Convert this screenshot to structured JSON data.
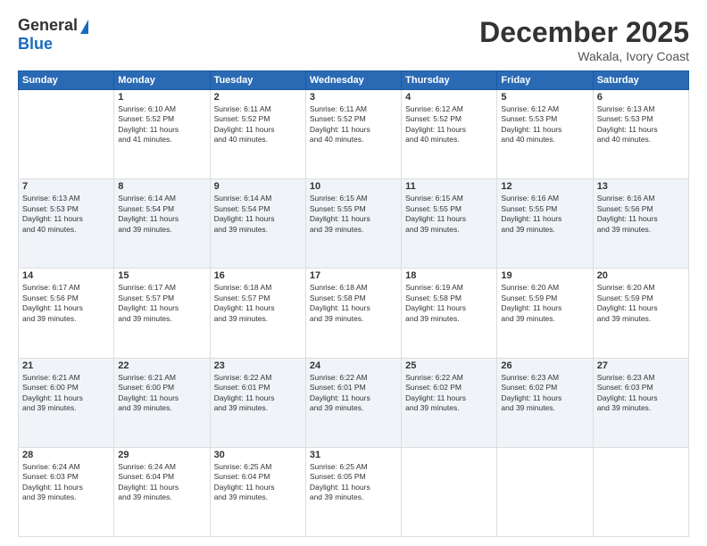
{
  "header": {
    "logo_general": "General",
    "logo_blue": "Blue",
    "month_title": "December 2025",
    "location": "Wakala, Ivory Coast"
  },
  "days_of_week": [
    "Sunday",
    "Monday",
    "Tuesday",
    "Wednesday",
    "Thursday",
    "Friday",
    "Saturday"
  ],
  "weeks": [
    [
      {
        "day": "",
        "info": ""
      },
      {
        "day": "1",
        "info": "Sunrise: 6:10 AM\nSunset: 5:52 PM\nDaylight: 11 hours\nand 41 minutes."
      },
      {
        "day": "2",
        "info": "Sunrise: 6:11 AM\nSunset: 5:52 PM\nDaylight: 11 hours\nand 40 minutes."
      },
      {
        "day": "3",
        "info": "Sunrise: 6:11 AM\nSunset: 5:52 PM\nDaylight: 11 hours\nand 40 minutes."
      },
      {
        "day": "4",
        "info": "Sunrise: 6:12 AM\nSunset: 5:52 PM\nDaylight: 11 hours\nand 40 minutes."
      },
      {
        "day": "5",
        "info": "Sunrise: 6:12 AM\nSunset: 5:53 PM\nDaylight: 11 hours\nand 40 minutes."
      },
      {
        "day": "6",
        "info": "Sunrise: 6:13 AM\nSunset: 5:53 PM\nDaylight: 11 hours\nand 40 minutes."
      }
    ],
    [
      {
        "day": "7",
        "info": "Sunrise: 6:13 AM\nSunset: 5:53 PM\nDaylight: 11 hours\nand 40 minutes."
      },
      {
        "day": "8",
        "info": "Sunrise: 6:14 AM\nSunset: 5:54 PM\nDaylight: 11 hours\nand 39 minutes."
      },
      {
        "day": "9",
        "info": "Sunrise: 6:14 AM\nSunset: 5:54 PM\nDaylight: 11 hours\nand 39 minutes."
      },
      {
        "day": "10",
        "info": "Sunrise: 6:15 AM\nSunset: 5:55 PM\nDaylight: 11 hours\nand 39 minutes."
      },
      {
        "day": "11",
        "info": "Sunrise: 6:15 AM\nSunset: 5:55 PM\nDaylight: 11 hours\nand 39 minutes."
      },
      {
        "day": "12",
        "info": "Sunrise: 6:16 AM\nSunset: 5:55 PM\nDaylight: 11 hours\nand 39 minutes."
      },
      {
        "day": "13",
        "info": "Sunrise: 6:16 AM\nSunset: 5:56 PM\nDaylight: 11 hours\nand 39 minutes."
      }
    ],
    [
      {
        "day": "14",
        "info": "Sunrise: 6:17 AM\nSunset: 5:56 PM\nDaylight: 11 hours\nand 39 minutes."
      },
      {
        "day": "15",
        "info": "Sunrise: 6:17 AM\nSunset: 5:57 PM\nDaylight: 11 hours\nand 39 minutes."
      },
      {
        "day": "16",
        "info": "Sunrise: 6:18 AM\nSunset: 5:57 PM\nDaylight: 11 hours\nand 39 minutes."
      },
      {
        "day": "17",
        "info": "Sunrise: 6:18 AM\nSunset: 5:58 PM\nDaylight: 11 hours\nand 39 minutes."
      },
      {
        "day": "18",
        "info": "Sunrise: 6:19 AM\nSunset: 5:58 PM\nDaylight: 11 hours\nand 39 minutes."
      },
      {
        "day": "19",
        "info": "Sunrise: 6:20 AM\nSunset: 5:59 PM\nDaylight: 11 hours\nand 39 minutes."
      },
      {
        "day": "20",
        "info": "Sunrise: 6:20 AM\nSunset: 5:59 PM\nDaylight: 11 hours\nand 39 minutes."
      }
    ],
    [
      {
        "day": "21",
        "info": "Sunrise: 6:21 AM\nSunset: 6:00 PM\nDaylight: 11 hours\nand 39 minutes."
      },
      {
        "day": "22",
        "info": "Sunrise: 6:21 AM\nSunset: 6:00 PM\nDaylight: 11 hours\nand 39 minutes."
      },
      {
        "day": "23",
        "info": "Sunrise: 6:22 AM\nSunset: 6:01 PM\nDaylight: 11 hours\nand 39 minutes."
      },
      {
        "day": "24",
        "info": "Sunrise: 6:22 AM\nSunset: 6:01 PM\nDaylight: 11 hours\nand 39 minutes."
      },
      {
        "day": "25",
        "info": "Sunrise: 6:22 AM\nSunset: 6:02 PM\nDaylight: 11 hours\nand 39 minutes."
      },
      {
        "day": "26",
        "info": "Sunrise: 6:23 AM\nSunset: 6:02 PM\nDaylight: 11 hours\nand 39 minutes."
      },
      {
        "day": "27",
        "info": "Sunrise: 6:23 AM\nSunset: 6:03 PM\nDaylight: 11 hours\nand 39 minutes."
      }
    ],
    [
      {
        "day": "28",
        "info": "Sunrise: 6:24 AM\nSunset: 6:03 PM\nDaylight: 11 hours\nand 39 minutes."
      },
      {
        "day": "29",
        "info": "Sunrise: 6:24 AM\nSunset: 6:04 PM\nDaylight: 11 hours\nand 39 minutes."
      },
      {
        "day": "30",
        "info": "Sunrise: 6:25 AM\nSunset: 6:04 PM\nDaylight: 11 hours\nand 39 minutes."
      },
      {
        "day": "31",
        "info": "Sunrise: 6:25 AM\nSunset: 6:05 PM\nDaylight: 11 hours\nand 39 minutes."
      },
      {
        "day": "",
        "info": ""
      },
      {
        "day": "",
        "info": ""
      },
      {
        "day": "",
        "info": ""
      }
    ]
  ]
}
